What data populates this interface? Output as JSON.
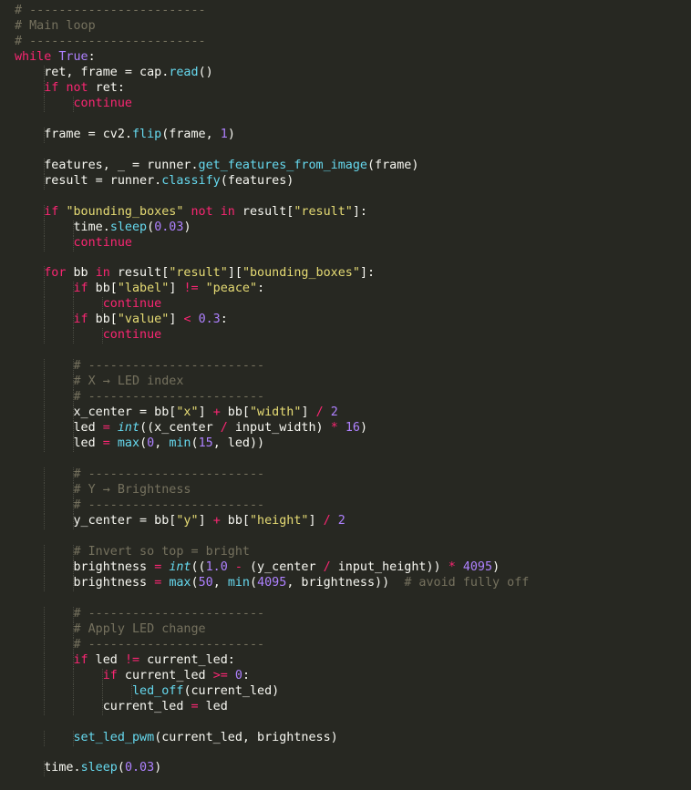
{
  "editor": {
    "theme_colors": {
      "background": "#272822",
      "plain": "#f8f8f2",
      "keyword": "#f92672",
      "function": "#66d9ef",
      "string": "#e6db74",
      "number": "#ae81ff",
      "comment": "#75715e"
    },
    "lines": [
      [
        [
          "com",
          "# ------------------------"
        ]
      ],
      [
        [
          "com",
          "# Main loop"
        ]
      ],
      [
        [
          "com",
          "# ------------------------"
        ]
      ],
      [
        [
          "kw",
          "while"
        ],
        [
          "plain",
          " "
        ],
        [
          "const",
          "True"
        ],
        [
          "plain",
          ":"
        ]
      ],
      [
        [
          "plain",
          "    ret, frame = cap."
        ],
        [
          "fn",
          "read"
        ],
        [
          "plain",
          "()"
        ]
      ],
      [
        [
          "plain",
          "    "
        ],
        [
          "kw",
          "if"
        ],
        [
          "plain",
          " "
        ],
        [
          "kw",
          "not"
        ],
        [
          "plain",
          " ret:"
        ]
      ],
      [
        [
          "plain",
          "        "
        ],
        [
          "kw",
          "continue"
        ]
      ],
      [
        [
          "plain",
          ""
        ]
      ],
      [
        [
          "plain",
          "    frame = cv2."
        ],
        [
          "fn",
          "flip"
        ],
        [
          "plain",
          "(frame, "
        ],
        [
          "num",
          "1"
        ],
        [
          "plain",
          ")"
        ]
      ],
      [
        [
          "plain",
          ""
        ]
      ],
      [
        [
          "plain",
          "    features, _ = runner."
        ],
        [
          "fn",
          "get_features_from_image"
        ],
        [
          "plain",
          "(frame)"
        ]
      ],
      [
        [
          "plain",
          "    result = runner."
        ],
        [
          "fn",
          "classify"
        ],
        [
          "plain",
          "(features)"
        ]
      ],
      [
        [
          "plain",
          ""
        ]
      ],
      [
        [
          "plain",
          "    "
        ],
        [
          "kw",
          "if"
        ],
        [
          "plain",
          " "
        ],
        [
          "str",
          "\"bounding_boxes\""
        ],
        [
          "plain",
          " "
        ],
        [
          "kw",
          "not"
        ],
        [
          "plain",
          " "
        ],
        [
          "kw",
          "in"
        ],
        [
          "plain",
          " result["
        ],
        [
          "str",
          "\"result\""
        ],
        [
          "plain",
          "]:"
        ]
      ],
      [
        [
          "plain",
          "        time."
        ],
        [
          "fn",
          "sleep"
        ],
        [
          "plain",
          "("
        ],
        [
          "num",
          "0.03"
        ],
        [
          "plain",
          ")"
        ]
      ],
      [
        [
          "plain",
          "        "
        ],
        [
          "kw",
          "continue"
        ]
      ],
      [
        [
          "plain",
          ""
        ]
      ],
      [
        [
          "plain",
          "    "
        ],
        [
          "kw",
          "for"
        ],
        [
          "plain",
          " bb "
        ],
        [
          "kw",
          "in"
        ],
        [
          "plain",
          " result["
        ],
        [
          "str",
          "\"result\""
        ],
        [
          "plain",
          "]["
        ],
        [
          "str",
          "\"bounding_boxes\""
        ],
        [
          "plain",
          "]:"
        ]
      ],
      [
        [
          "plain",
          "        "
        ],
        [
          "kw",
          "if"
        ],
        [
          "plain",
          " bb["
        ],
        [
          "str",
          "\"label\""
        ],
        [
          "plain",
          "] "
        ],
        [
          "op",
          "!="
        ],
        [
          "plain",
          " "
        ],
        [
          "str",
          "\"peace\""
        ],
        [
          "plain",
          ":"
        ]
      ],
      [
        [
          "plain",
          "            "
        ],
        [
          "kw",
          "continue"
        ]
      ],
      [
        [
          "plain",
          "        "
        ],
        [
          "kw",
          "if"
        ],
        [
          "plain",
          " bb["
        ],
        [
          "str",
          "\"value\""
        ],
        [
          "plain",
          "] "
        ],
        [
          "op",
          "<"
        ],
        [
          "plain",
          " "
        ],
        [
          "num",
          "0.3"
        ],
        [
          "plain",
          ":"
        ]
      ],
      [
        [
          "plain",
          "            "
        ],
        [
          "kw",
          "continue"
        ]
      ],
      [
        [
          "plain",
          ""
        ]
      ],
      [
        [
          "plain",
          "        "
        ],
        [
          "com",
          "# ------------------------"
        ]
      ],
      [
        [
          "plain",
          "        "
        ],
        [
          "com",
          "# X → LED index"
        ]
      ],
      [
        [
          "plain",
          "        "
        ],
        [
          "com",
          "# ------------------------"
        ]
      ],
      [
        [
          "plain",
          "        x_center = bb["
        ],
        [
          "str",
          "\"x\""
        ],
        [
          "plain",
          "] "
        ],
        [
          "op",
          "+"
        ],
        [
          "plain",
          " bb["
        ],
        [
          "str",
          "\"width\""
        ],
        [
          "plain",
          "] "
        ],
        [
          "op",
          "/"
        ],
        [
          "plain",
          " "
        ],
        [
          "num",
          "2"
        ]
      ],
      [
        [
          "plain",
          "        led "
        ],
        [
          "op",
          "="
        ],
        [
          "plain",
          " "
        ],
        [
          "type",
          "int"
        ],
        [
          "plain",
          "((x_center "
        ],
        [
          "op",
          "/"
        ],
        [
          "plain",
          " input_width) "
        ],
        [
          "op",
          "*"
        ],
        [
          "plain",
          " "
        ],
        [
          "num",
          "16"
        ],
        [
          "plain",
          ")"
        ]
      ],
      [
        [
          "plain",
          "        led "
        ],
        [
          "op",
          "="
        ],
        [
          "plain",
          " "
        ],
        [
          "fn",
          "max"
        ],
        [
          "plain",
          "("
        ],
        [
          "num",
          "0"
        ],
        [
          "plain",
          ", "
        ],
        [
          "fn",
          "min"
        ],
        [
          "plain",
          "("
        ],
        [
          "num",
          "15"
        ],
        [
          "plain",
          ", led))"
        ]
      ],
      [
        [
          "plain",
          ""
        ]
      ],
      [
        [
          "plain",
          "        "
        ],
        [
          "com",
          "# ------------------------"
        ]
      ],
      [
        [
          "plain",
          "        "
        ],
        [
          "com",
          "# Y → Brightness"
        ]
      ],
      [
        [
          "plain",
          "        "
        ],
        [
          "com",
          "# ------------------------"
        ]
      ],
      [
        [
          "plain",
          "        y_center = bb["
        ],
        [
          "str",
          "\"y\""
        ],
        [
          "plain",
          "] "
        ],
        [
          "op",
          "+"
        ],
        [
          "plain",
          " bb["
        ],
        [
          "str",
          "\"height\""
        ],
        [
          "plain",
          "] "
        ],
        [
          "op",
          "/"
        ],
        [
          "plain",
          " "
        ],
        [
          "num",
          "2"
        ]
      ],
      [
        [
          "plain",
          ""
        ]
      ],
      [
        [
          "plain",
          "        "
        ],
        [
          "com",
          "# Invert so top = bright"
        ]
      ],
      [
        [
          "plain",
          "        brightness "
        ],
        [
          "op",
          "="
        ],
        [
          "plain",
          " "
        ],
        [
          "type",
          "int"
        ],
        [
          "plain",
          "(("
        ],
        [
          "num",
          "1.0"
        ],
        [
          "plain",
          " "
        ],
        [
          "op",
          "-"
        ],
        [
          "plain",
          " (y_center "
        ],
        [
          "op",
          "/"
        ],
        [
          "plain",
          " input_height)) "
        ],
        [
          "op",
          "*"
        ],
        [
          "plain",
          " "
        ],
        [
          "num",
          "4095"
        ],
        [
          "plain",
          ")"
        ]
      ],
      [
        [
          "plain",
          "        brightness "
        ],
        [
          "op",
          "="
        ],
        [
          "plain",
          " "
        ],
        [
          "fn",
          "max"
        ],
        [
          "plain",
          "("
        ],
        [
          "num",
          "50"
        ],
        [
          "plain",
          ", "
        ],
        [
          "fn",
          "min"
        ],
        [
          "plain",
          "("
        ],
        [
          "num",
          "4095"
        ],
        [
          "plain",
          ", brightness))  "
        ],
        [
          "com",
          "# avoid fully off"
        ]
      ],
      [
        [
          "plain",
          ""
        ]
      ],
      [
        [
          "plain",
          "        "
        ],
        [
          "com",
          "# ------------------------"
        ]
      ],
      [
        [
          "plain",
          "        "
        ],
        [
          "com",
          "# Apply LED change"
        ]
      ],
      [
        [
          "plain",
          "        "
        ],
        [
          "com",
          "# ------------------------"
        ]
      ],
      [
        [
          "plain",
          "        "
        ],
        [
          "kw",
          "if"
        ],
        [
          "plain",
          " led "
        ],
        [
          "op",
          "!="
        ],
        [
          "plain",
          " current_led:"
        ]
      ],
      [
        [
          "plain",
          "            "
        ],
        [
          "kw",
          "if"
        ],
        [
          "plain",
          " current_led "
        ],
        [
          "op",
          ">="
        ],
        [
          "plain",
          " "
        ],
        [
          "num",
          "0"
        ],
        [
          "plain",
          ":"
        ]
      ],
      [
        [
          "plain",
          "                "
        ],
        [
          "fn",
          "led_off"
        ],
        [
          "plain",
          "(current_led)"
        ]
      ],
      [
        [
          "plain",
          "            current_led "
        ],
        [
          "op",
          "="
        ],
        [
          "plain",
          " led"
        ]
      ],
      [
        [
          "plain",
          ""
        ]
      ],
      [
        [
          "plain",
          "        "
        ],
        [
          "fn",
          "set_led_pwm"
        ],
        [
          "plain",
          "(current_led, brightness)"
        ]
      ],
      [
        [
          "plain",
          ""
        ]
      ],
      [
        [
          "plain",
          "    time."
        ],
        [
          "fn",
          "sleep"
        ],
        [
          "plain",
          "("
        ],
        [
          "num",
          "0.03"
        ],
        [
          "plain",
          ")"
        ]
      ]
    ]
  }
}
